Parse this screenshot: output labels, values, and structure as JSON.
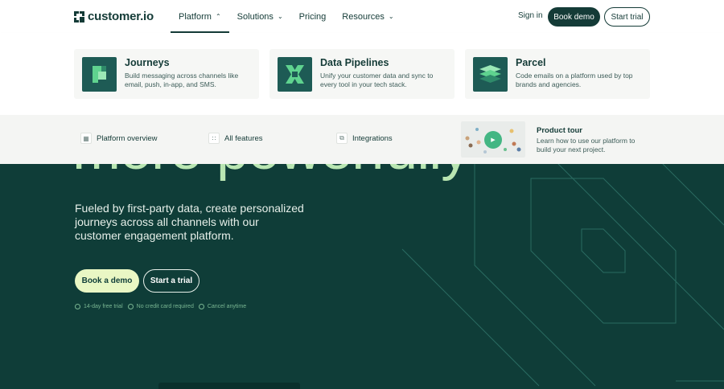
{
  "brand": {
    "name": "customer.io"
  },
  "nav": {
    "items": [
      {
        "label": "Platform",
        "chevron": "up"
      },
      {
        "label": "Solutions",
        "chevron": "down"
      },
      {
        "label": "Pricing"
      },
      {
        "label": "Resources",
        "chevron": "down"
      }
    ],
    "sign_in": "Sign in",
    "book_demo": "Book demo",
    "start_trial": "Start trial"
  },
  "mega_menu": {
    "products": [
      {
        "title": "Journeys",
        "description": "Build messaging across channels like email, push, in-app, and SMS.",
        "icon": "journeys-icon"
      },
      {
        "title": "Data Pipelines",
        "description": "Unify your customer data and sync to every tool in your tech stack.",
        "icon": "data-pipelines-icon"
      },
      {
        "title": "Parcel",
        "description": "Code emails on a platform used by top brands and agencies.",
        "icon": "parcel-icon"
      }
    ],
    "links": [
      {
        "label": "Platform overview",
        "icon": "grid-icon"
      },
      {
        "label": "All features",
        "icon": "dots-grid-icon"
      },
      {
        "label": "Integrations",
        "icon": "integrations-icon"
      }
    ],
    "product_tour": {
      "title": "Product tour",
      "description": "Learn how to use our platform to build your next project."
    }
  },
  "hero": {
    "heading_fragment": "more powerfully",
    "subheading": "Fueled by first-party data, create personalized journeys across all channels with our customer engagement platform.",
    "book_demo": "Book a demo",
    "start_trial": "Start a trial",
    "perks": [
      "14-day free trial",
      "No credit card required",
      "Cancel anytime"
    ]
  },
  "colors": {
    "dark_green": "#0f3d38",
    "brand_text": "#143b37",
    "accent_mint": "#b9e6b2",
    "cta_light": "#e9f7c4",
    "play_green": "#43b683"
  }
}
